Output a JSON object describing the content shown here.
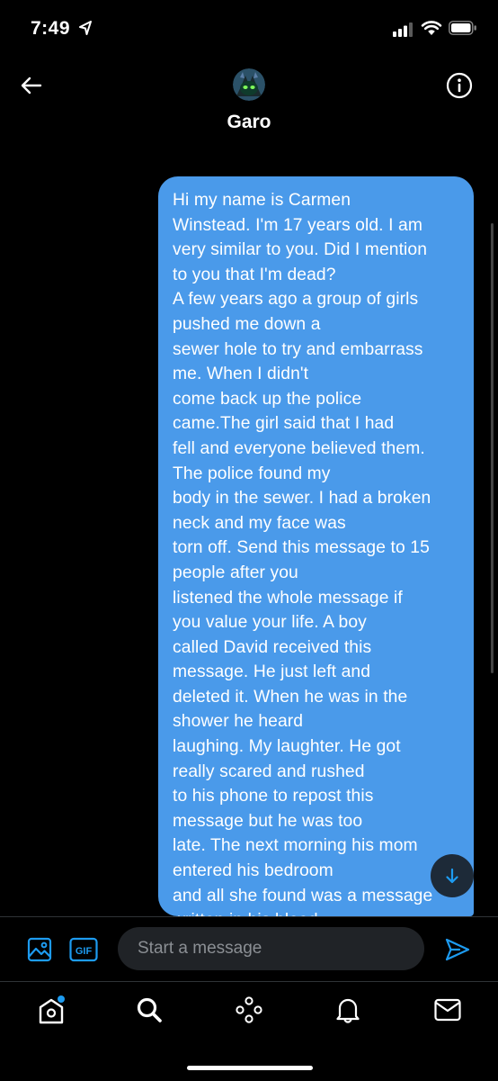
{
  "status_bar": {
    "time": "7:49"
  },
  "header": {
    "name": "Garo"
  },
  "conversation": {
    "message": "Hi my name is Carmen\nWinstead. I'm 17 years old. I am\nvery similar to you. Did I mention\nto you that I'm dead?\nA few years ago a group of girls\npushed me down a\nsewer hole to try and embarrass\nme. When I didn't\ncome back up the police\ncame.The girl said that I had\nfell and everyone believed them.\nThe police found my\nbody in the sewer. I had a broken\nneck and my face was\ntorn off. Send this message to 15\npeople after you\nlistened the whole message if\nyou value your life. A boy\ncalled David received this\nmessage. He just left and\ndeleted it. When he was in the\nshower he heard\nlaughing. My laughter. He got\nreally scared and rushed\nto his phone to repost this\nmessage but he was too\nlate. The next morning his mom\nentered his bedroom\nand all she found was a message\nwritten in his blood"
  },
  "composer": {
    "placeholder": "Start a message",
    "gif_label": "GIF"
  },
  "icons": {
    "back": "arrow-left-icon",
    "info": "info-icon",
    "image": "image-icon",
    "gif": "gif-icon",
    "send": "send-icon",
    "home": "home-icon",
    "search": "search-icon",
    "spaces": "spaces-icon",
    "notifications": "bell-icon",
    "messages": "mail-icon",
    "scroll": "arrow-down-icon"
  },
  "colors": {
    "accent": "#1d9bf0",
    "bubble": "#4a9aea",
    "background": "#000000"
  }
}
